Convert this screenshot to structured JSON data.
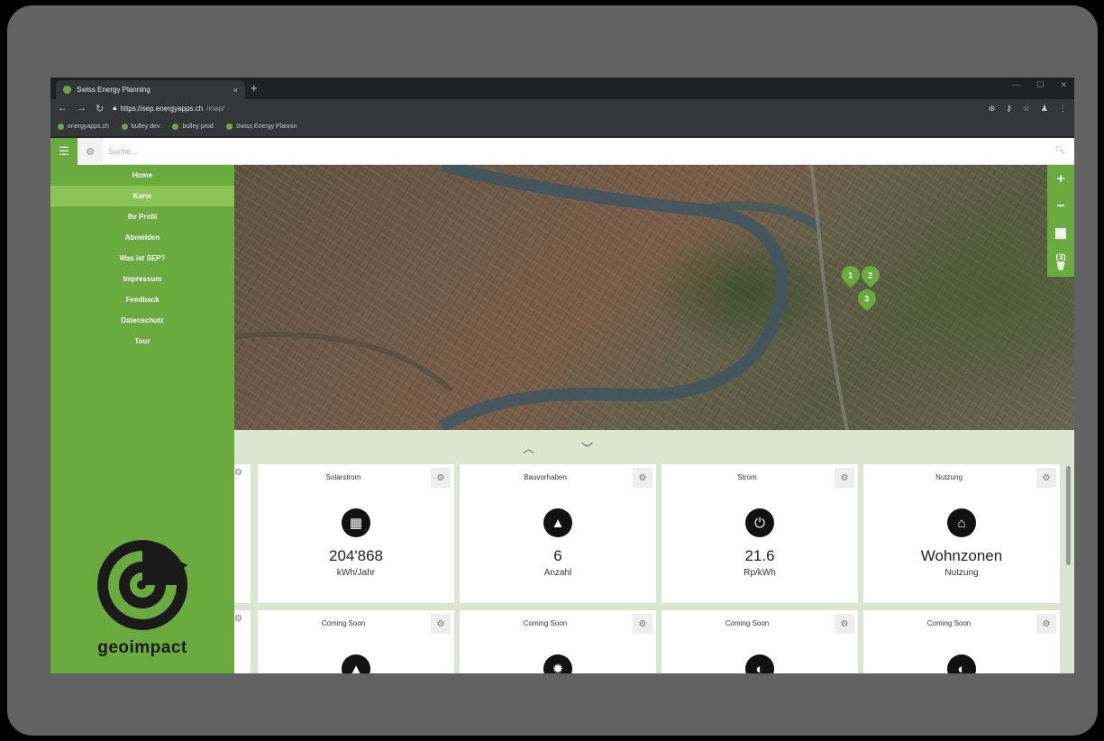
{
  "browser": {
    "tab_title": "Swiss Energy Planning",
    "tab_close": "×",
    "new_tab": "+",
    "url_host": "https://sep.energyapps.ch",
    "url_path": "/map/",
    "bookmarks": [
      "energyapps.ch",
      "bulley dev",
      "bulley prod",
      "Swiss Energy Plannin"
    ]
  },
  "search": {
    "placeholder": "Suche..."
  },
  "sidebar": {
    "items": [
      {
        "label": "Home"
      },
      {
        "label": "Karte"
      },
      {
        "label": "Ihr Profil"
      },
      {
        "label": "Abmelden"
      },
      {
        "label": "Was ist SEP?"
      },
      {
        "label": "Impressum"
      },
      {
        "label": "Feedback"
      },
      {
        "label": "Datenschutz"
      },
      {
        "label": "Tour"
      }
    ],
    "active": "Karte",
    "logo_text": "geoimpact"
  },
  "map": {
    "controls": {
      "zoom_in": "+",
      "zoom_out": "−",
      "selection_count": "(3)"
    },
    "markers": [
      "1",
      "2",
      "3"
    ]
  },
  "dashboard": {
    "cards_row1": [
      {
        "title": "Solarstrom",
        "value": "204'868",
        "unit": "kWh/Jahr",
        "icon": "solar-panel-icon"
      },
      {
        "title": "Bauvorhaben",
        "value": "6",
        "unit": "Anzahl",
        "icon": "traffic-cone-icon"
      },
      {
        "title": "Strom",
        "value": "21.6",
        "unit": "Rp/kWh",
        "icon": "plug-icon"
      },
      {
        "title": "Nutzung",
        "value": "Wohnzonen",
        "unit": "Nutzung",
        "icon": "house-icon"
      }
    ],
    "cards_row2": [
      {
        "title": "Coming Soon"
      },
      {
        "title": "Coming Soon"
      },
      {
        "title": "Coming Soon"
      },
      {
        "title": "Coming Soon"
      }
    ]
  },
  "colors": {
    "brand_green": "#6aaa3e",
    "active_green": "#8cc456",
    "panel_bg": "#dbe6d1"
  }
}
